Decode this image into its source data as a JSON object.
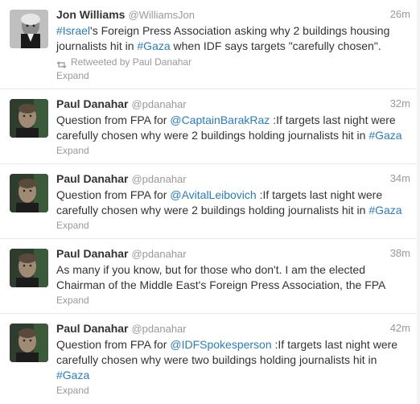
{
  "tweets": [
    {
      "fullname": "Jon Williams",
      "username": "@WilliamsJon",
      "time": "26m",
      "parts": [
        {
          "t": "#Israel",
          "link": true
        },
        {
          "t": "'s Foreign Press Association asking why 2 buildings housing journalists hit in ",
          "link": false
        },
        {
          "t": "#Gaza",
          "link": true
        },
        {
          "t": " when IDF says targets \"carefully chosen\".",
          "link": false
        }
      ],
      "retweeted_by": "Retweeted by Paul Danahar",
      "expand": "Expand",
      "avatar": "grey-haired-man-avatar"
    },
    {
      "fullname": "Paul Danahar",
      "username": "@pdanahar",
      "time": "32m",
      "parts": [
        {
          "t": "Question from FPA for ",
          "link": false
        },
        {
          "t": "@CaptainBarakRaz",
          "link": true
        },
        {
          "t": " :If targets last night were carefully chosen why were 2 buildings holding journalists hit in ",
          "link": false
        },
        {
          "t": "#Gaza",
          "link": true
        }
      ],
      "expand": "Expand",
      "avatar": "paul-danahar-avatar"
    },
    {
      "fullname": "Paul Danahar",
      "username": "@pdanahar",
      "time": "34m",
      "parts": [
        {
          "t": "Question from FPA for ",
          "link": false
        },
        {
          "t": "@AvitalLeibovich",
          "link": true
        },
        {
          "t": " :If targets last night were carefully chosen why were 2 buildings holding journalists hit in ",
          "link": false
        },
        {
          "t": "#Gaza",
          "link": true
        }
      ],
      "expand": "Expand",
      "avatar": "paul-danahar-avatar"
    },
    {
      "fullname": "Paul Danahar",
      "username": "@pdanahar",
      "time": "38m",
      "parts": [
        {
          "t": "As many if you know, but for those who don't. I am the elected Chairman of the Middle East's Foreign Press Association, the FPA",
          "link": false
        }
      ],
      "expand": "Expand",
      "avatar": "paul-danahar-avatar"
    },
    {
      "fullname": "Paul Danahar",
      "username": "@pdanahar",
      "time": "42m",
      "parts": [
        {
          "t": "Question from FPA for ",
          "link": false
        },
        {
          "t": "@IDFSpokesperson",
          "link": true
        },
        {
          "t": " :If targets last night were carefully chosen why were two buildings holding journalists hit in ",
          "link": false
        },
        {
          "t": "#Gaza",
          "link": true
        }
      ],
      "expand": "Expand",
      "avatar": "paul-danahar-avatar"
    }
  ],
  "colors": {
    "link": "#2a7cc4",
    "muted": "#999999",
    "text": "#333333",
    "divider": "#e8e8e8"
  }
}
